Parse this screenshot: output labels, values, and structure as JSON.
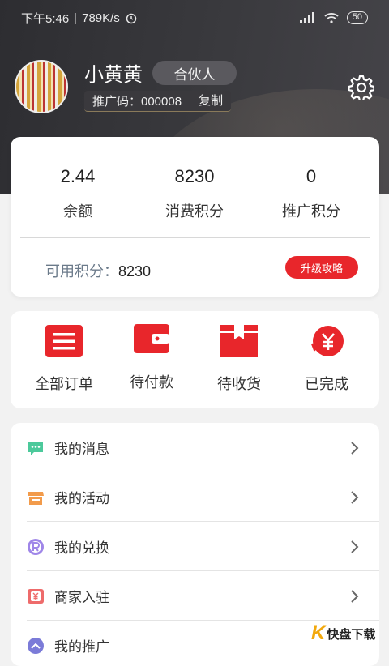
{
  "status_bar": {
    "time": "下午5:46",
    "speed": "789K/s",
    "battery": "50"
  },
  "profile": {
    "username": "小黄黄",
    "badge": "合伙人",
    "promo_label": "推广码：000008",
    "copy_label": "复制"
  },
  "stats": {
    "items": [
      {
        "value": "2.44",
        "label": "余额"
      },
      {
        "value": "8230",
        "label": "消费积分"
      },
      {
        "value": "0",
        "label": "推广积分"
      }
    ],
    "available_label": "可用积分：",
    "available_value": "8230",
    "upgrade_label": "升级攻略"
  },
  "orders": {
    "items": [
      {
        "label": "全部订单",
        "icon": "list-icon"
      },
      {
        "label": "待付款",
        "icon": "wallet-icon"
      },
      {
        "label": "待收货",
        "icon": "package-icon"
      },
      {
        "label": "已完成",
        "icon": "yuan-refund-icon"
      }
    ]
  },
  "menu": {
    "items": [
      {
        "label": "我的消息",
        "icon": "message-icon",
        "color": "#4cc99b"
      },
      {
        "label": "我的活动",
        "icon": "shop-icon",
        "color": "#f29b4b"
      },
      {
        "label": "我的兑换",
        "icon": "exchange-r-icon",
        "color": "#9f86e8"
      },
      {
        "label": "商家入驻",
        "icon": "yuan-card-icon",
        "color": "#ee6b6b"
      },
      {
        "label": "我的推广",
        "icon": "share-icon",
        "color": "#7b7bd8"
      }
    ]
  },
  "watermark": {
    "brand_k": "K",
    "brand_text": "快盘下载"
  },
  "colors": {
    "accent_red": "#e8262b",
    "header_dark": "#2d2d31"
  }
}
